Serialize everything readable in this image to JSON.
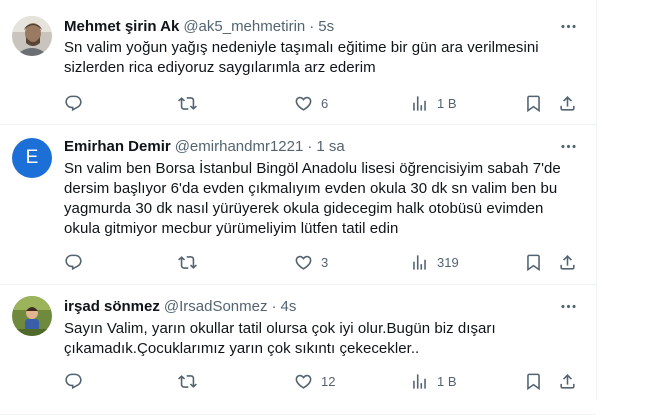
{
  "tweets": [
    {
      "name": "Mehmet şirin Ak",
      "handle": "@ak5_mehmetirin",
      "time": "5s",
      "lines": [
        "Sn valim yoğun yağış nedeniyle taşımalı eğitime bir gün ara verilmesini",
        "sizlerden rica ediyoruz saygılarımla arz ederim"
      ],
      "reply_count": "",
      "retweet_count": "",
      "like_count": "6",
      "view_count": "1 B"
    },
    {
      "name": "Emirhan Demir",
      "handle": "@emirhandmr1221",
      "time": "1 sa",
      "avatar_letter": "E",
      "lines": [
        "Sn valim ben Borsa İstanbul Bingöl Anadolu lisesi öğrencisiyim sabah 7'de",
        "dersim başlıyor 6'da evden çıkmalıyım evden okula 30 dk sn valim ben bu",
        "yagmurda 30 dk nasıl yürüyerek okula gidecegim halk otobüsü evimden",
        "okula gitmiyor mecbur yürümeliyim lütfen tatil edin"
      ],
      "reply_count": "",
      "retweet_count": "",
      "like_count": "3",
      "view_count": "319"
    },
    {
      "name": "irşad sönmez",
      "handle": "@IrsadSonmez",
      "time": "4s",
      "lines": [
        "Sayın Valim, yarın okullar tatil olursa çok iyi olur.Bugün biz dışarı",
        "çıkamadık.Çocuklarımız yarın çok sıkıntı çekecekler.."
      ],
      "reply_count": "",
      "retweet_count": "",
      "like_count": "12",
      "view_count": "1 B"
    }
  ],
  "colors": {
    "text": "#0f1419",
    "muted": "#536471",
    "divider": "#eff3f4",
    "avatar_e": "#1d6fd8"
  },
  "icons": [
    "reply-icon",
    "retweet-icon",
    "like-icon",
    "views-icon",
    "bookmark-icon",
    "share-icon",
    "more-icon"
  ]
}
